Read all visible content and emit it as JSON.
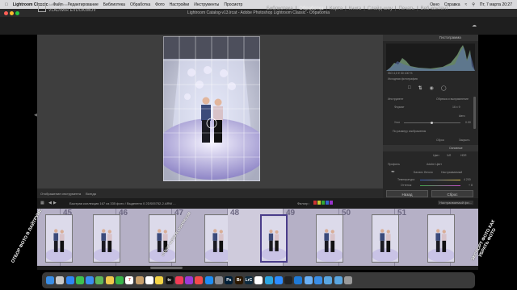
{
  "menubar": {
    "app": "Lightroom Classic",
    "items": [
      "Файл",
      "Редактирование",
      "Библиотека",
      "Обработка",
      "Фото",
      "Настройки",
      "Инструменты",
      "Просмотр"
    ],
    "right_items": [
      "Окно",
      "Справка"
    ],
    "clock": "Пт, 7 марта  20:27"
  },
  "window": {
    "title": "Lightroom Catalog-v13.lrcat - Adobe Photoshop Lightroom Classic - Обработка"
  },
  "identity": {
    "catalog_label": "Adobe Lightroom Classic",
    "user_name": "VLADIMIR EVDOKIMOV",
    "logo": "Lrc"
  },
  "modules": [
    "Библиотека",
    "Обработка",
    "Карта",
    "Книга",
    "Слайд-шоу",
    "Печать",
    "Веб-контент"
  ],
  "active_module": "Обработка",
  "right_panel": {
    "histogram_title": "Гистограмма",
    "histogram_readout": "ISO  4,0   f/   30   100 %",
    "original_photo": "Исходная фотография",
    "tool_label": "Инструмент",
    "tool_value": "Обрезка и выпрямление",
    "aspect_label": "Формат",
    "aspect_value": "16 х 9",
    "auto_label": "Авто",
    "angle_label": "Угол",
    "angle_value": "0.00",
    "constrain_label": "По размеру изображения",
    "reset_label": "Сброс",
    "close_label": "Закрыть",
    "basic_title": "Основные",
    "treatment": [
      "Цвет",
      "Ч/б",
      "HDR"
    ],
    "profile_label": "Профиль",
    "profile_value": "Adobe Цвет",
    "wb_label": "Баланс белого",
    "wb_value": "Настраиваемый",
    "temp_label": "Температура",
    "temp_value": "4 200",
    "tint_label": "Оттенок",
    "tint_value": "+ 8",
    "prev_button": "Назад",
    "reset_button": "Сброс"
  },
  "toolbar": {
    "label": "Отображение инструмента",
    "value": "Всегда"
  },
  "filmbar": {
    "info": "Быстрая коллекция   167 из 335 фото /  Выделено 0   2DS05752-2.ARW ...",
    "filter_label": "Фильтр :",
    "filter_value": "Настраиваемый фи..."
  },
  "filmstrip": {
    "numbers": [
      "45",
      "46",
      "47",
      "48",
      "49",
      "50",
      "51"
    ],
    "selected_number": "48"
  },
  "overlays": {
    "left_caption": "ОТБОР ФОТО В ЛАЙТРУМЕ",
    "mid_caption": "ОТБОР ФОТО В LIGHTROOM",
    "right_caption": "ЭКСПОРТ ФОТО КАК УБРАТЬ ФОТО"
  },
  "dock": {
    "icons": [
      "finder-icon",
      "launchpad-icon",
      "safari-icon",
      "messages-icon",
      "mail-icon",
      "maps-icon",
      "photos-icon",
      "facetime-icon",
      "calendar-icon",
      "contacts-icon",
      "reminders-icon",
      "notes-icon",
      "tv-icon",
      "music-icon",
      "podcasts-icon",
      "news-icon",
      "appstore-icon",
      "settings-icon",
      "photoshop-icon",
      "bridge-icon",
      "lrc-icon",
      "chrome-icon",
      "telegram-icon",
      "zoom-icon",
      "terminal-icon",
      "vscode-icon",
      "preview-icon",
      "finder2-icon",
      "folder-icon",
      "folder2-icon",
      "trash-icon"
    ],
    "colors": [
      "#3a8ee6",
      "#c9c9c9",
      "#2f86f5",
      "#3fc24f",
      "#3b8ef0",
      "#5fb85a",
      "#f2c94c",
      "#39b54a",
      "#ffffff",
      "#c8a06b",
      "#ffffff",
      "#f5d546",
      "#111111",
      "#f23c57",
      "#9b3bd8",
      "#f24a4a",
      "#1d8ef5",
      "#8e8e93",
      "#001e36",
      "#2a1700",
      "#0f2b3e",
      "#ffffff",
      "#2ca5e0",
      "#2d8cff",
      "#222222",
      "#1f7ad6",
      "#6ab0f5",
      "#3a8ee6",
      "#5aa6e0",
      "#5aa6e0",
      "#9a9a9a"
    ],
    "labels": [
      "",
      "",
      "",
      "",
      "",
      "",
      "",
      "",
      "7",
      "",
      "",
      "",
      "tv",
      "",
      "",
      "",
      "",
      "",
      "Ps",
      "Br",
      "LrC",
      "",
      "",
      "",
      "",
      "",
      "",
      "",
      "",
      "",
      ""
    ]
  },
  "colors": {
    "accent": "#4a3d8a",
    "panel": "#272727",
    "filmstrip": "#b5b0c6"
  }
}
